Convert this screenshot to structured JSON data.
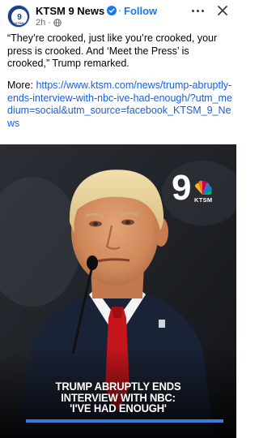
{
  "post": {
    "page_name": "KTSM 9 News",
    "follow_label": "Follow",
    "separator": "·",
    "time": "2h",
    "avatar_text": "KTSM",
    "text": "“They’re crooked, just like you’re crooked, your press is crooked. And ‘Meet the Press’ is crooked,” Trump remarked.",
    "more_label": "More: ",
    "link": "https://www.ktsm.com/news/trump-abruptly-ends-interview-with-nbc-ive-had-enough/?utm_medium=social&utm_source=facebook_KTSM_9_News"
  },
  "media": {
    "logo_number": "9",
    "logo_text": "KTSM",
    "headline_lines": [
      "TRUMP ABRUPTLY ENDS",
      "INTERVIEW WITH NBC:",
      "'I'VE HAD ENOUGH'"
    ]
  },
  "icons": {
    "verified": "verified-badge-icon",
    "privacy": "globe-icon",
    "more": "more-options-icon",
    "close": "close-icon",
    "network": "peacock-icon"
  },
  "colors": {
    "link": "#1a5fd8",
    "follow": "#1877f2",
    "headline_bar": "#3b7bd8",
    "verified": "#1877f2"
  }
}
